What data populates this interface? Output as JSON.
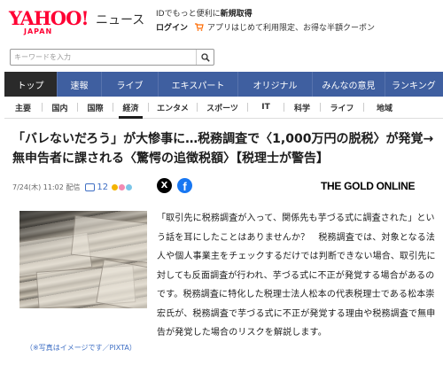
{
  "header": {
    "logo_main": "YAHOO!",
    "logo_sub": "JAPAN",
    "service_name": "ニュース",
    "promo_line1_prefix": "IDでもっと便利に",
    "promo_line1_link": "新規取得",
    "login_label": "ログイン",
    "promo_line2": "アプリはじめて利用限定、お得な半額クーポン",
    "cart_icon": "cart-icon"
  },
  "search": {
    "placeholder": "キーワードを入力"
  },
  "nav": {
    "items": [
      {
        "label": "トップ",
        "active": true
      },
      {
        "label": "速報"
      },
      {
        "label": "ライブ"
      },
      {
        "label": "エキスパート"
      },
      {
        "label": "オリジナル"
      },
      {
        "label": "みんなの意見"
      },
      {
        "label": "ランキング"
      }
    ],
    "active_color": "#2a2a2a",
    "bar_color": "#3f5fa0"
  },
  "subnav": {
    "items": [
      {
        "label": "主要"
      },
      {
        "label": "国内"
      },
      {
        "label": "国際"
      },
      {
        "label": "経済",
        "active": true
      },
      {
        "label": "エンタメ"
      },
      {
        "label": "スポーツ"
      },
      {
        "label": "IT"
      },
      {
        "label": "科学"
      },
      {
        "label": "ライフ"
      },
      {
        "label": "地域"
      }
    ]
  },
  "article": {
    "headline": "「バレないだろう」が大惨事に…税務調査で〈1,000万円の脱税〉が発覚→無申告者に課される〈驚愕の追徴税額〉【税理士が警告】",
    "date": "7/24(木) 11:02 配信",
    "comment_count": "12",
    "share_x_label": "X",
    "share_fb_label": "f",
    "source": "THE GOLD ONLINE",
    "photo_caption": "（※写真はイメージです／PIXTA）",
    "body": "「取引先に税務調査が入って、関係先も芋づる式に調査された」という話を耳にしたことはありませんか？　税務調査では、対象となる法人や個人事業主をチェックするだけでは判断できない場合、取引先に対しても反面調査が行われ、芋づる式に不正が発覚する場合があるのです。税務調査に特化した税理士法人松本の代表税理士である松本崇宏氏が、税務調査で芋づる式に不正が発覚する理由や税務調査で無申告が発覚した場合のリスクを解説します。"
  }
}
